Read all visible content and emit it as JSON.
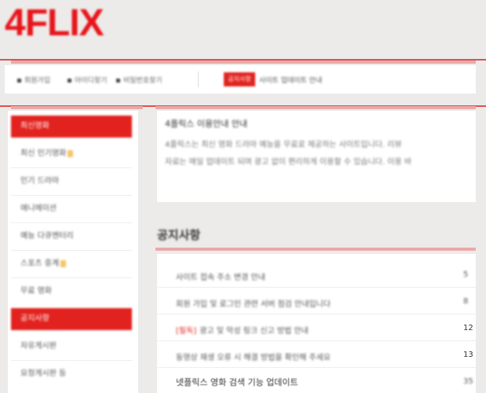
{
  "logo": "4FLIX",
  "topbar": {
    "links": [
      "회원가입",
      "아이디찾기",
      "비밀번호찾기"
    ],
    "notice_badge": "공지사항",
    "notice_text": "사이트 업데이트 안내"
  },
  "sidebar": {
    "items": [
      {
        "label": "최신영화",
        "active": true,
        "hot": false
      },
      {
        "label": "최신 인기영화",
        "active": false,
        "hot": true
      },
      {
        "label": "인기 드라마",
        "active": false,
        "hot": false
      },
      {
        "label": "애니메이션",
        "active": false,
        "hot": false
      },
      {
        "label": "예능 다큐멘터리",
        "active": false,
        "hot": false
      },
      {
        "label": "스포츠 중계",
        "active": false,
        "hot": true
      },
      {
        "label": "무료 영화",
        "active": false,
        "hot": false
      },
      {
        "label": "공지사항",
        "active": true,
        "hot": false
      },
      {
        "label": "자유게시판",
        "active": false,
        "hot": false
      },
      {
        "label": "요청게시판 등",
        "active": false,
        "hot": false
      }
    ]
  },
  "intro": {
    "title": "4플릭스 이용안내 안내",
    "lines": [
      "4플릭스는 최신 영화 드라마 예능을 무료로 제공하는 사이트입니다. 리뷰",
      "자료는 매일 업데이트 되며 광고 없이 편리하게 이용할 수 있습니다. 이용 바"
    ]
  },
  "section": {
    "title": "공지사항"
  },
  "list": {
    "rows": [
      {
        "tag": "",
        "title": "사이트 접속 주소 변경 안내",
        "num": "5"
      },
      {
        "tag": "",
        "title": "회원 가입 및 로그인 관련 서버 점검 안내입니다",
        "num": "8"
      },
      {
        "tag": "[필독]",
        "title": "광고 및 악성 링크 신고 방법 안내",
        "num": "12"
      },
      {
        "tag": "",
        "title": "동영상 재생 오류 시 해결 방법을 확인해 주세요",
        "num": "13"
      },
      {
        "tag": "",
        "title": "넷플릭스 영화 검색 기능 업데이트",
        "num": "35"
      }
    ]
  },
  "colors": {
    "accent": "#e2221e",
    "pink_band": "#eba9a9",
    "background": "#ecebea"
  }
}
